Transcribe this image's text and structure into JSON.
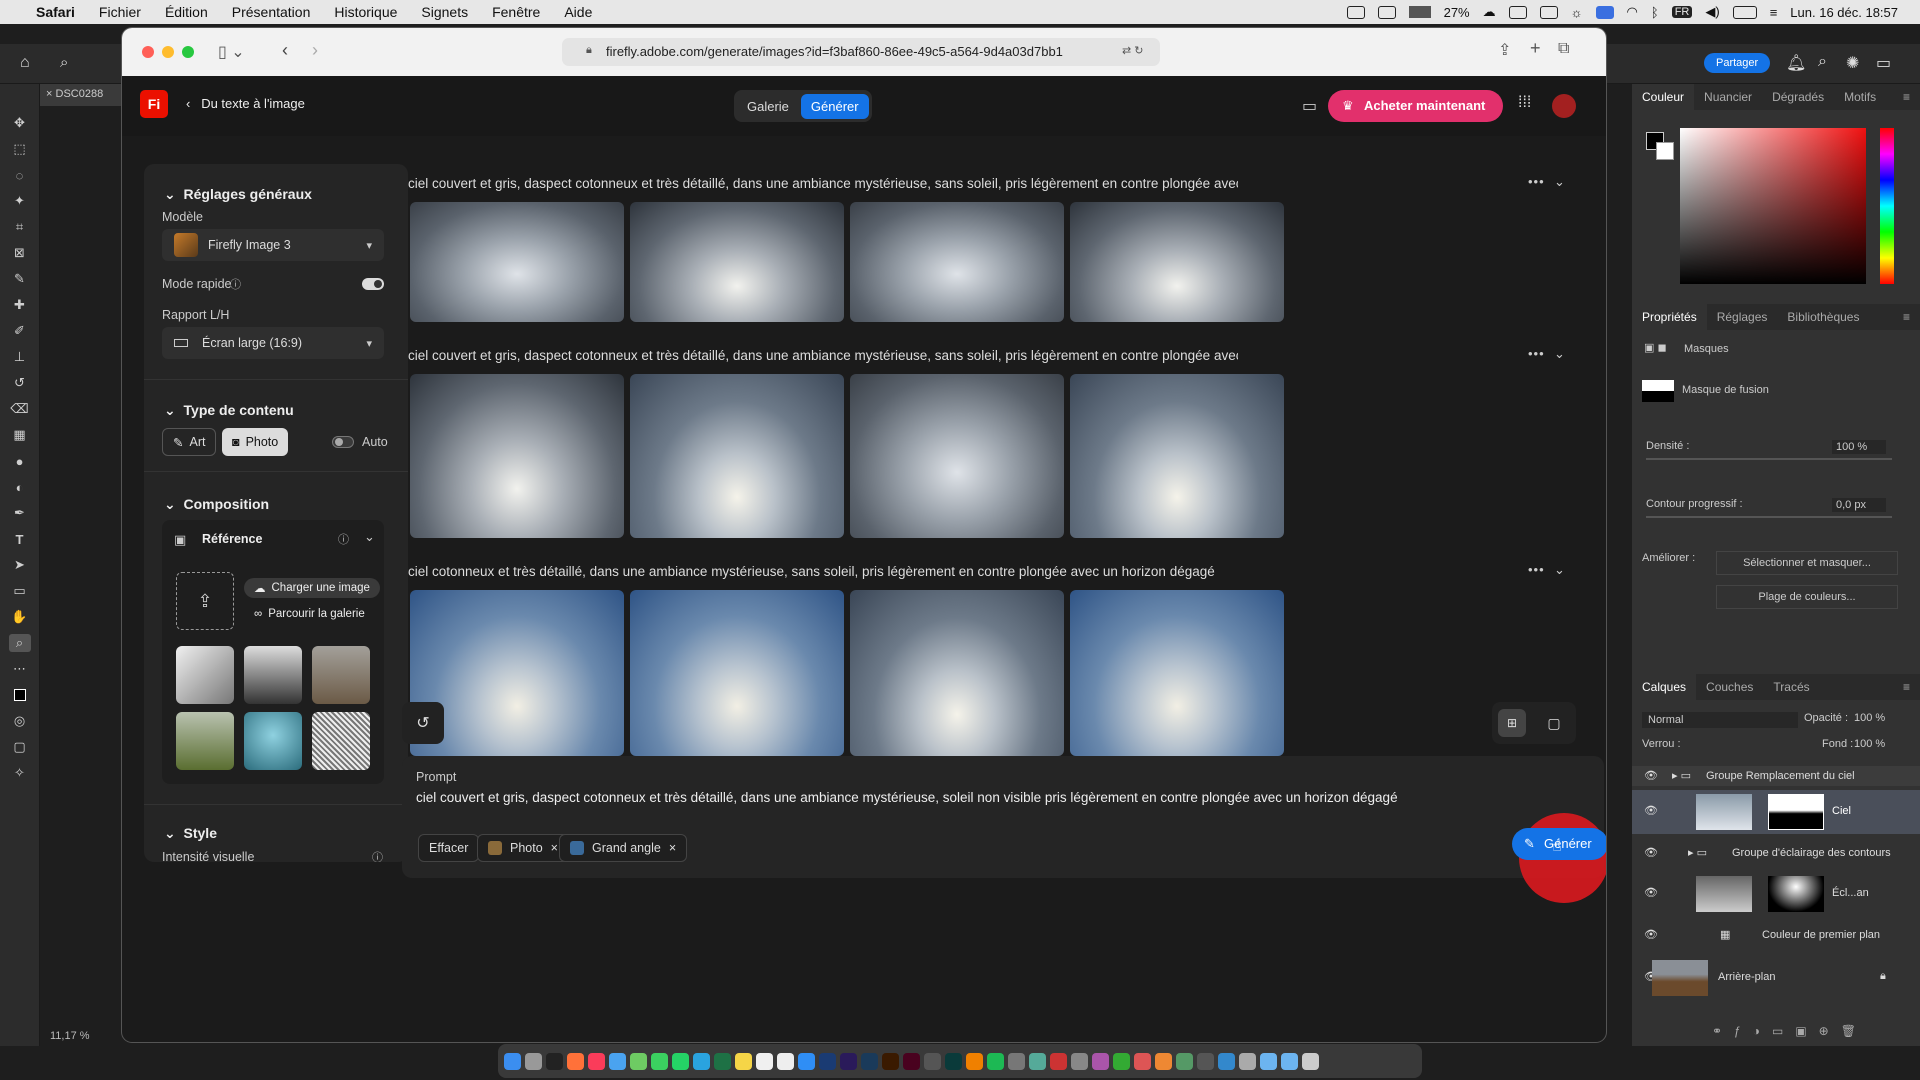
{
  "menubar": {
    "app": "Safari",
    "items": [
      "Fichier",
      "Édition",
      "Présentation",
      "Historique",
      "Signets",
      "Fenêtre",
      "Aide"
    ],
    "battery_cpu": "27%",
    "lang": "FR",
    "datetime": "Lun. 16 déc. 18:57"
  },
  "photoshop": {
    "doc_tab": "DSC0288",
    "zoom": "11,17 %",
    "share_label": "Partager",
    "color_tabs": [
      "Couleur",
      "Nuancier",
      "Dégradés",
      "Motifs"
    ],
    "prop_tabs": [
      "Propriétés",
      "Réglages",
      "Bibliothèques"
    ],
    "masks_label": "Masques",
    "fusion_mask": "Masque de fusion",
    "density_label": "Densité :",
    "density_value": "100 %",
    "feather_label": "Contour progressif :",
    "feather_value": "0,0 px",
    "improve_label": "Améliorer :",
    "select_mask_btn": "Sélectionner et masquer...",
    "color_range_btn": "Plage de couleurs...",
    "layer_tabs": [
      "Calques",
      "Couches",
      "Tracés"
    ],
    "blend_mode": "Normal",
    "opacity_label": "Opacité :",
    "opacity_value": "100 %",
    "lock_label": "Verrou :",
    "fill_label": "Fond :",
    "fill_value": "100 %",
    "layers": [
      {
        "name": "Groupe Remplacement du ciel"
      },
      {
        "name": "Ciel"
      },
      {
        "name": "Groupe d'éclairage des contours"
      },
      {
        "name": "Écl...an"
      },
      {
        "name": "Couleur de premier plan"
      },
      {
        "name": "Arrière-plan"
      }
    ]
  },
  "safari": {
    "url": "firefly.adobe.com/generate/images?id=f3baf860-86ee-49c5-a564-9d4a03d7bb1"
  },
  "firefly": {
    "logo": "Fi",
    "back_label": "Du texte à l'image",
    "seg": [
      "Galerie",
      "Générer"
    ],
    "buy_label": "Acheter maintenant",
    "left": {
      "general_title": "Réglages généraux",
      "model_label": "Modèle",
      "model_value": "Firefly Image 3",
      "fast_mode_label": "Mode rapide",
      "ratio_label": "Rapport L/H",
      "ratio_value": "Écran large (16:9)",
      "content_title": "Type de contenu",
      "art_label": "Art",
      "photo_label": "Photo",
      "auto_label": "Auto",
      "composition_title": "Composition",
      "reference_label": "Référence",
      "upload_label": "Charger une image",
      "browse_label": "Parcourir la galerie",
      "style_title": "Style",
      "intensity_label": "Intensité visuelle"
    },
    "rows": [
      {
        "prompt": "ciel couvert et gris, daspect cotonneux et très détaillé, dans une ambiance mystérieuse, sans soleil, pris légèrement en contre plongée avec un horizon dég..."
      },
      {
        "prompt": "ciel couvert et gris, daspect cotonneux et très détaillé, dans une ambiance mystérieuse, sans soleil, pris légèrement en contre plongée avec un horizon dég..."
      },
      {
        "prompt": "ciel cotonneux et très détaillé, dans une ambiance mystérieuse, sans soleil, pris légèrement en contre plongée avec un horizon dégagé"
      }
    ],
    "prompt_bar": {
      "label": "Prompt",
      "text": "ciel couvert et gris, daspect cotonneux et très détaillé, dans une ambiance mystérieuse, soleil non visible pris légèrement en contre plongée avec un horizon dégagé",
      "clear_label": "Effacer",
      "tag1": "Photo",
      "tag2": "Grand angle",
      "generate_label": "Générer"
    }
  }
}
